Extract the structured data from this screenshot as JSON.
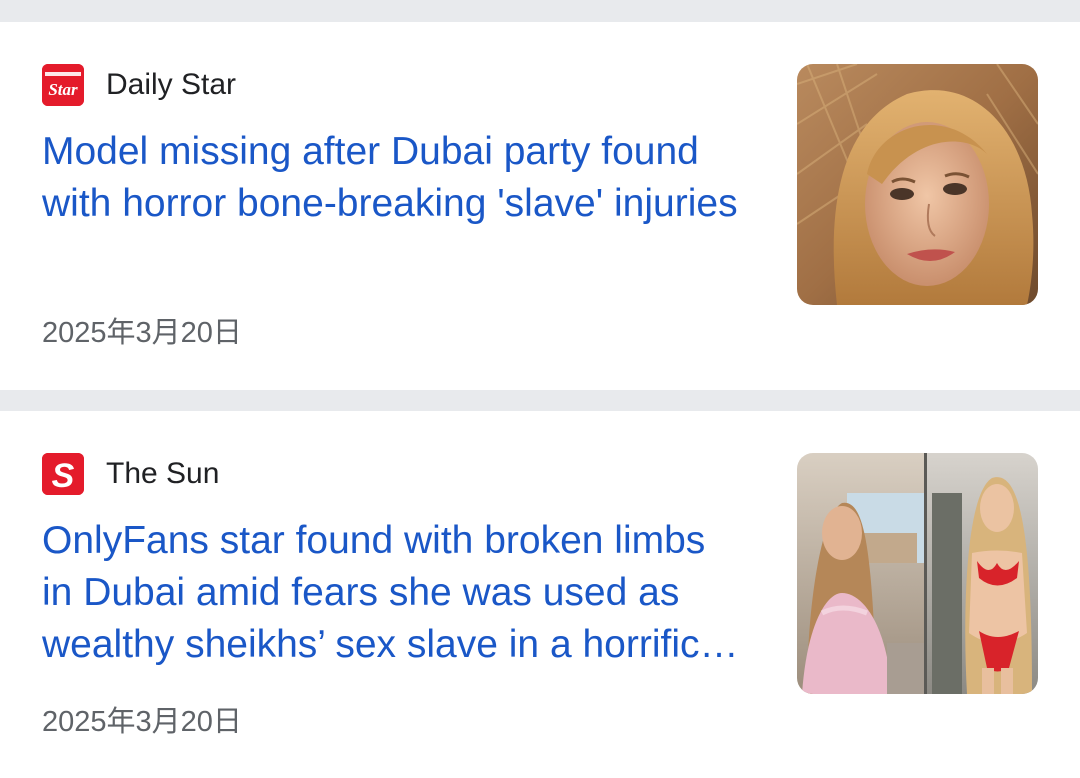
{
  "articles": [
    {
      "source": "Daily Star",
      "logo_icon": "daily-star-logo-icon",
      "logo_text": "Star",
      "logo_color": "#e41b2b",
      "headline": "Model missing after Dubai party found with horror bone-breaking 'slave' injuries",
      "date": "2025年3月20日",
      "thumbnail": "woman-portrait-image"
    },
    {
      "source": "The Sun",
      "logo_icon": "the-sun-logo-icon",
      "logo_text": "S",
      "logo_color": "#e41b2b",
      "headline": "OnlyFans star found with broken limbs in Dubai amid fears she was used as wealthy sheikhs’ sex slave in a horrific ordeal",
      "date": "2025年3月20日",
      "thumbnail": "two-photos-collage-image"
    }
  ],
  "colors": {
    "headline": "#1a57c7",
    "separator": "#e8eaed",
    "date": "#5f6368"
  }
}
